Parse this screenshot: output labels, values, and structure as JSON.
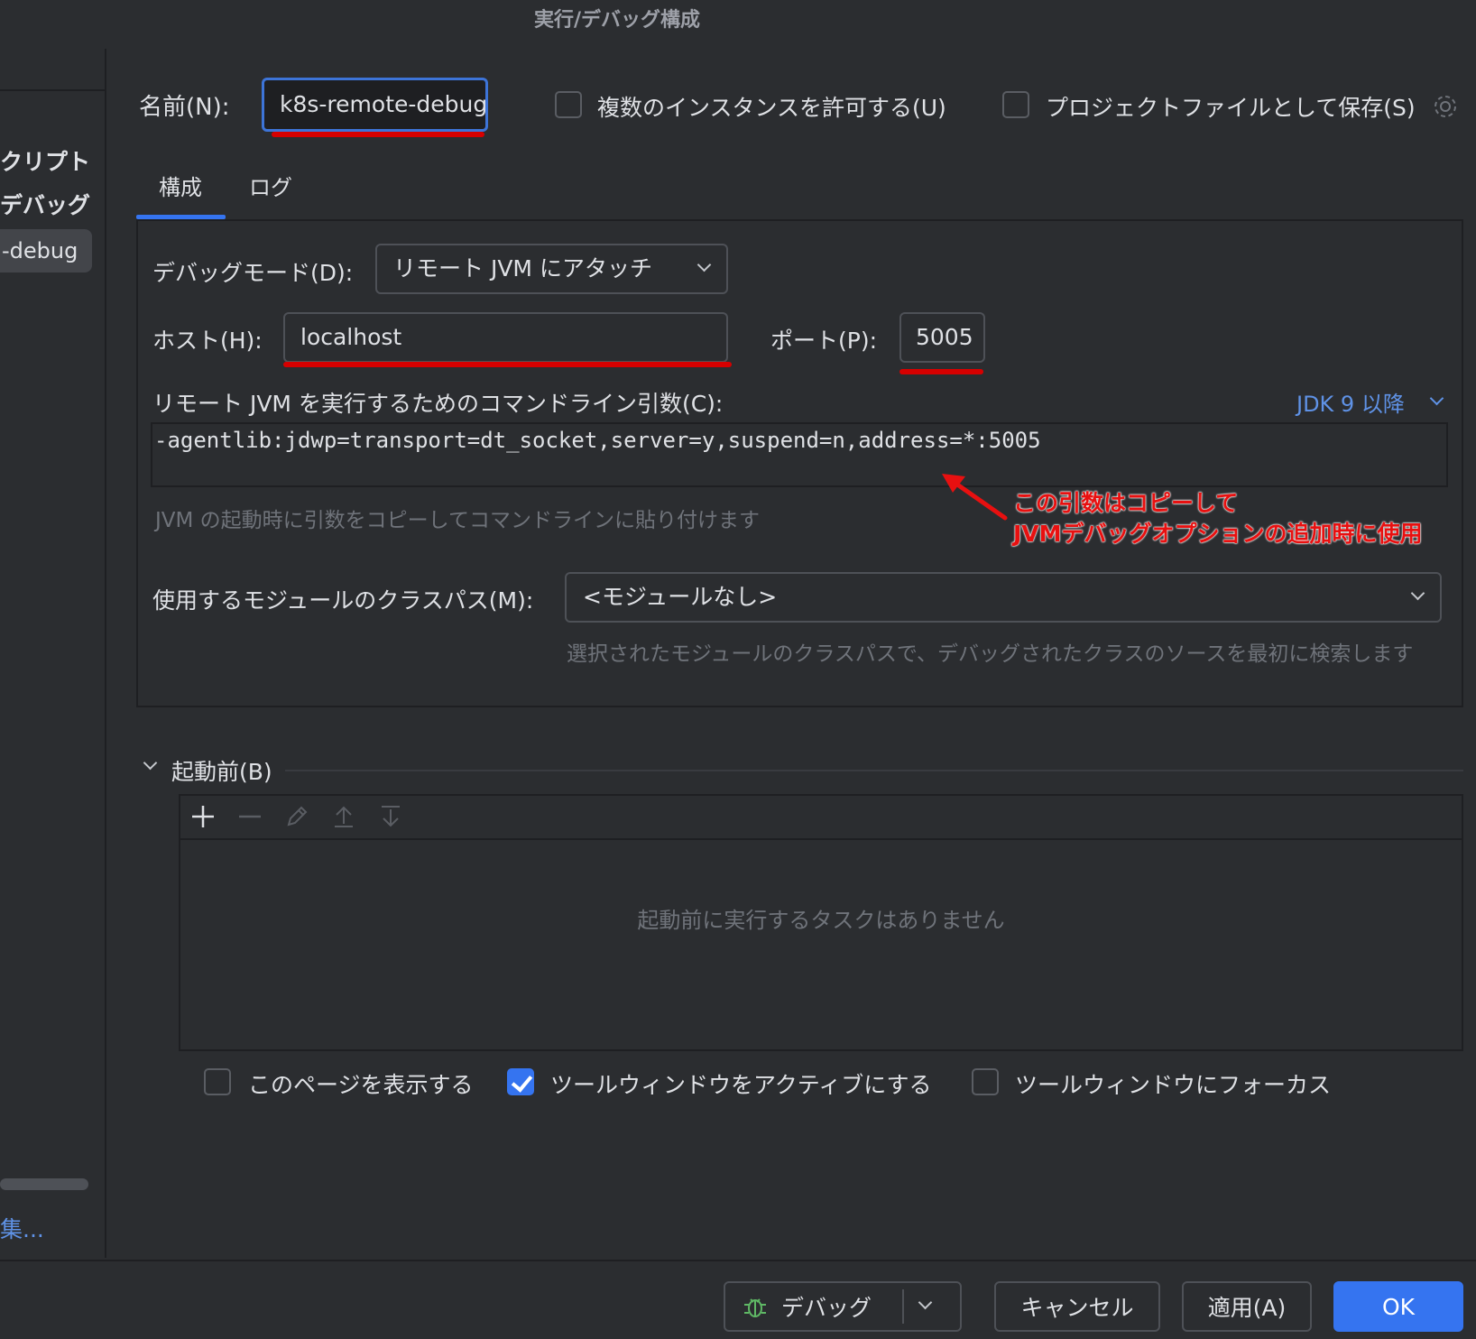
{
  "window": {
    "title": "実行/デバッグ構成"
  },
  "sidebar": {
    "items": [
      "クリプト",
      "デバッグ"
    ],
    "selected": "-debug",
    "edit_link": "集..."
  },
  "header": {
    "name_label": "名前(N):",
    "name_value": "k8s-remote-debug",
    "allow_multiple_label": "複数のインスタンスを許可する(U)",
    "allow_multiple_checked": false,
    "store_as_project_label": "プロジェクトファイルとして保存(S)",
    "store_as_project_checked": false
  },
  "tabs": [
    {
      "label": "構成",
      "active": true
    },
    {
      "label": "ログ",
      "active": false
    }
  ],
  "config": {
    "debug_mode_label": "デバッグモード(D):",
    "debug_mode_value": "リモート JVM にアタッチ",
    "host_label": "ホスト(H):",
    "host_value": "localhost",
    "port_label": "ポート(P):",
    "port_value": "5005",
    "cmdline_label": "リモート JVM を実行するためのコマンドライン引数(C):",
    "jdk_selector": "JDK 9 以降",
    "cmdline_value": "-agentlib:jdwp=transport=dt_socket,server=y,suspend=n,address=*:5005",
    "cmdline_hint": "JVM の起動時に引数をコピーしてコマンドラインに貼り付けます",
    "module_label": "使用するモジュールのクラスパス(M):",
    "module_value": "<モジュールなし>",
    "module_hint": "選択されたモジュールのクラスパスで、デバッグされたクラスのソースを最初に検索します"
  },
  "annotation": {
    "line1": "この引数はコピーして",
    "line2": "JVMデバッグオプションの追加時に使用",
    "color": "#e81010"
  },
  "before_launch": {
    "title": "起動前(B)",
    "empty_text": "起動前に実行するタスクはありません",
    "toolbar": [
      "plus-icon",
      "minus-icon",
      "pencil-icon",
      "move-up-icon",
      "move-down-icon"
    ]
  },
  "options": [
    {
      "label": "このページを表示する",
      "checked": false
    },
    {
      "label": "ツールウィンドウをアクティブにする",
      "checked": true
    },
    {
      "label": "ツールウィンドウにフォーカス",
      "checked": false
    }
  ],
  "footer": {
    "debug_label": "デバッグ",
    "cancel_label": "キャンセル",
    "apply_label": "適用(A)",
    "ok_label": "OK"
  },
  "colors": {
    "background": "#2b2d30",
    "accent": "#3574f0",
    "link": "#5f92e6",
    "highlight_red": "#d60000"
  }
}
